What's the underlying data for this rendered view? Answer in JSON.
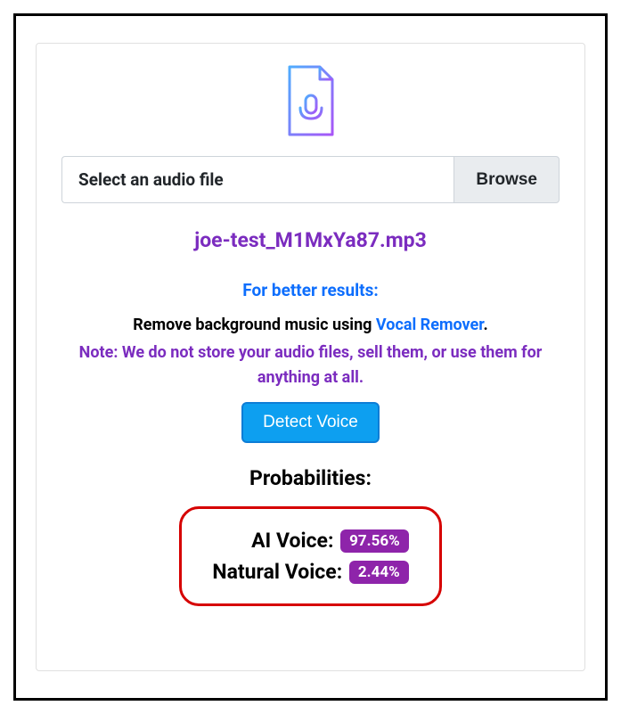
{
  "file_input": {
    "placeholder": "Select an audio file",
    "browse_label": "Browse"
  },
  "filename": "joe-test_M1MxYa87.mp3",
  "instructions": {
    "heading": "For better results:",
    "line1_prefix": "Remove background music using ",
    "line1_link": "Vocal Remover",
    "line1_suffix": ".",
    "note": "Note: We do not store your audio files, sell them, or use them for anything at all."
  },
  "detect_button": "Detect Voice",
  "results": {
    "heading": "Probabilities:",
    "ai_label": "AI Voice:",
    "ai_value": "97.56%",
    "natural_label": "Natural Voice:",
    "natural_value": "2.44%"
  }
}
